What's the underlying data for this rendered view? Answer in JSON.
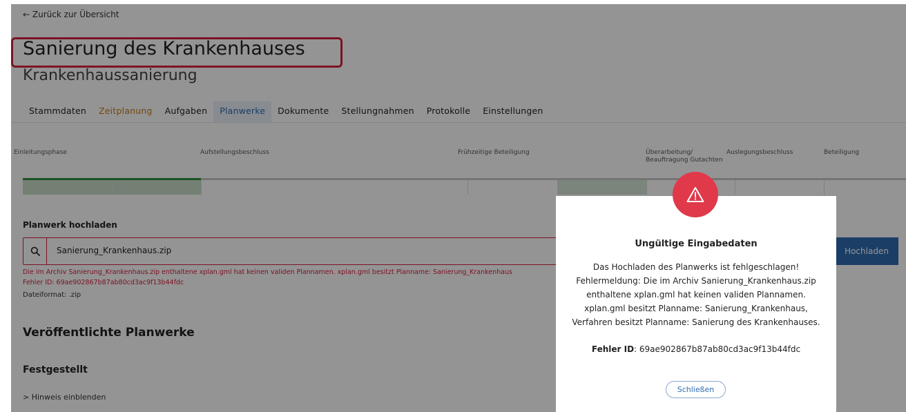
{
  "nav": {
    "back_label": "← Zurück zur Übersicht"
  },
  "header": {
    "title": "Sanierung des Krankenhauses",
    "subtitle": "Krankenhaussanierung"
  },
  "tabs": [
    {
      "label": "Stammdaten",
      "state": "default"
    },
    {
      "label": "Zeitplanung",
      "state": "highlight"
    },
    {
      "label": "Aufgaben",
      "state": "default"
    },
    {
      "label": "Planwerke",
      "state": "active"
    },
    {
      "label": "Dokumente",
      "state": "default"
    },
    {
      "label": "Stellungnahmen",
      "state": "default"
    },
    {
      "label": "Protokolle",
      "state": "default"
    },
    {
      "label": "Einstellungen",
      "state": "default"
    }
  ],
  "phases": [
    {
      "label": "Einleitungsphase"
    },
    {
      "label": "Aufstellungsbeschluss"
    },
    {
      "label": "Frühzeitige Beteiligung"
    },
    {
      "label": "Überarbeitung/ Beauftragung Gutachten"
    },
    {
      "label": "Auslegungsbeschluss"
    },
    {
      "label": "Beteiligung"
    }
  ],
  "upload": {
    "label": "Planwerk hochladen",
    "value": "Sanierung_Krankenhaus.zip",
    "button_label": "Hochladen",
    "error_line1": "Die im Archiv Sanierung_Krankenhaus.zip enthaltene xplan.gml hat keinen validen Plannamen. xplan.gml besitzt Planname: Sanierung_Krankenhaus",
    "error_line2": "Fehler ID: 69ae902867b87ab80cd3ac9f13b44fdc",
    "format_note": "Dateiformat: .zip"
  },
  "published": {
    "heading": "Veröffentlichte Planwerke",
    "subheading": "Festgestellt",
    "hint_label": "> Hinweis einblenden"
  },
  "modal": {
    "title": "Ungültige Eingabedaten",
    "body": "Das Hochladen des Planwerks ist fehlgeschlagen! Fehlermeldung: Die im Archiv Sanierung_Krankenhaus.zip enthaltene xplan.gml hat keinen validen Plannamen. xplan.gml besitzt Planname: Sanierung_Krankenhaus, Verfahren besitzt Planname: Sanierung des Krankenhauses.",
    "id_label": "Fehler ID",
    "id_value": ": 69ae902867b87ab80cd3ac9f13b44fdc",
    "close_label": "Schließen"
  },
  "colors": {
    "accent_blue": "#2d6bb0",
    "error_red": "#d51f3e",
    "progress_green": "#2f8f3b",
    "tab_orange": "#c87a14",
    "warning_red": "#e0394a"
  },
  "icons": {
    "search": "search-icon",
    "warning": "warning-triangle-icon"
  }
}
